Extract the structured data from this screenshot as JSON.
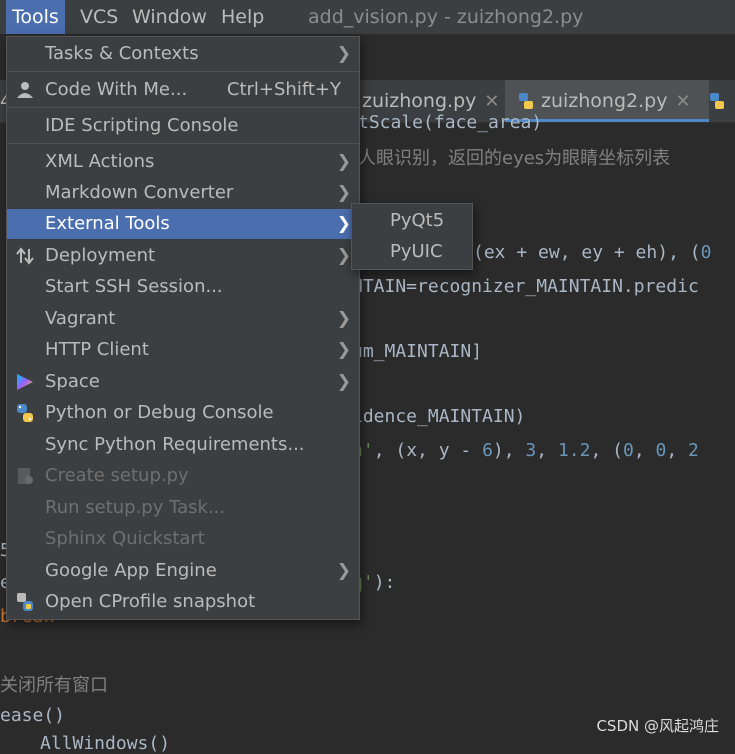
{
  "menubar": {
    "items": [
      "Tools",
      "VCS",
      "Window",
      "Help"
    ],
    "window_title": "add_vision.py - zuizhong2.py"
  },
  "tabs": [
    {
      "label": "zuizhong.py",
      "close": "✕"
    },
    {
      "label": "zuizhong2.py",
      "close": "✕"
    }
  ],
  "tools_menu": {
    "items": [
      {
        "label": "Tasks & Contexts",
        "submenu": true
      },
      {
        "label": "Code With Me...",
        "shortcut": "Ctrl+Shift+Y"
      },
      {
        "label": "IDE Scripting Console"
      },
      {
        "label": "XML Actions",
        "submenu": true
      },
      {
        "label": "Markdown Converter",
        "submenu": true
      },
      {
        "label": "External Tools",
        "submenu": true,
        "selected": true
      },
      {
        "label": "Deployment",
        "submenu": true
      },
      {
        "label": "Start SSH Session..."
      },
      {
        "label": "Vagrant",
        "submenu": true
      },
      {
        "label": "HTTP Client",
        "submenu": true
      },
      {
        "label": "Space",
        "submenu": true
      },
      {
        "label": "Python or Debug Console"
      },
      {
        "label": "Sync Python Requirements..."
      },
      {
        "label": "Create setup.py",
        "disabled": true
      },
      {
        "label": "Run setup.py Task...",
        "disabled": true
      },
      {
        "label": "Sphinx Quickstart",
        "disabled": true
      },
      {
        "label": "Google App Engine",
        "submenu": true
      },
      {
        "label": "Open CProfile snapshot"
      }
    ]
  },
  "external_tools_submenu": {
    "items": [
      "PyQt5",
      "PyUIC"
    ]
  },
  "editor": {
    "lines": {
      "l1": "tScale(face_area)",
      "l2": "人眼识别，返回的eyes为眼睛坐标列表",
      "l3a": "(ex + ew, ey + eh), (",
      "l3b": "0",
      "l4": "NTAIN=recognizer_MAINTAIN.predic",
      "l5": "um_MAINTAIN]",
      "l6": "idence_MAINTAIN)",
      "l7a": "n'",
      "l7b": ", (x, y - ",
      "l7c": "6",
      "l7d": "), ",
      "l7e": "3",
      "l7f": ", ",
      "l7g": "1.2",
      "l7h": ", (",
      "l7i": "0",
      "l7j": ", ",
      "l7k": "0",
      "l7l": ", ",
      "l7m": "2",
      "l8a": "q'",
      "l8b": "):",
      "l9": "break",
      "l10": "关闭所有窗口",
      "l11": "ease()",
      "l12": "AllWindows()",
      "gutter_4": "4",
      "gutter_5": "5",
      "gutter_e": "e"
    }
  },
  "watermark": "CSDN @风起鸿庄"
}
